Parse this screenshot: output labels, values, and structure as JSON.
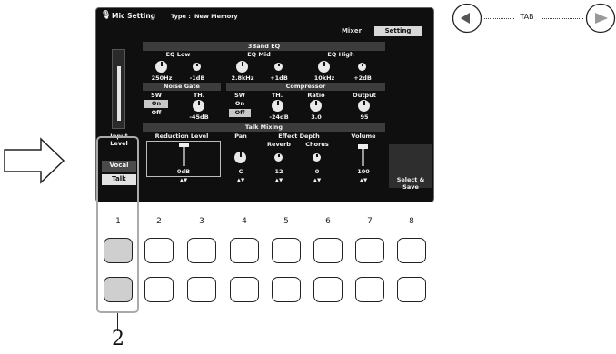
{
  "screen": {
    "title": "Mic Setting",
    "type_label": "Type :",
    "type_value": "New Memory",
    "tabs": [
      "Mixer",
      "Setting"
    ],
    "active_tab": "Setting",
    "input_level_label": "Input Level",
    "eq": {
      "header": "3Band EQ",
      "bands": [
        {
          "name": "EQ Low",
          "freq": "250Hz",
          "gain": "-1dB"
        },
        {
          "name": "EQ Mid",
          "freq": "2.8kHz",
          "gain": "+1dB"
        },
        {
          "name": "EQ High",
          "freq": "10kHz",
          "gain": "+2dB"
        }
      ]
    },
    "noise_gate": {
      "header": "Noise Gate",
      "sw_label": "SW",
      "th_label": "TH.",
      "sw_on": "On",
      "sw_off": "Off",
      "th_value": "-45dB"
    },
    "compressor": {
      "header": "Compressor",
      "sw_label": "SW",
      "sw_on": "On",
      "sw_off": "Off",
      "th_label": "TH.",
      "th_value": "-24dB",
      "ratio_label": "Ratio",
      "ratio_value": "3.0",
      "output_label": "Output",
      "output_value": "95"
    },
    "talk_mixing": {
      "header": "Talk Mixing",
      "reduction_label": "Reduction Level",
      "reduction_value": "0dB",
      "pan_label": "Pan",
      "pan_value": "C",
      "effect_depth_label": "Effect Depth",
      "reverb_label": "Reverb",
      "reverb_value": "12",
      "chorus_label": "Chorus",
      "chorus_value": "0",
      "volume_label": "Volume",
      "volume_value": "100"
    },
    "mode_tabs": [
      "Vocal",
      "Talk"
    ],
    "select_save": "Select & Save",
    "arrows": "▲▼"
  },
  "tab_nav": {
    "label": "TAB",
    "left_icon": "left-arrow-icon",
    "right_icon": "right-arrow-icon"
  },
  "button_numbers": [
    "1",
    "2",
    "3",
    "4",
    "5",
    "6",
    "7",
    "8"
  ],
  "callout": "2"
}
